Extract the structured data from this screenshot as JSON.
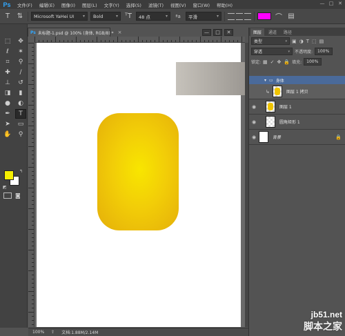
{
  "app": {
    "logo": "Ps"
  },
  "menu": [
    "文件(F)",
    "编辑(E)",
    "图像(I)",
    "图层(L)",
    "文字(Y)",
    "选择(S)",
    "滤镜(T)",
    "视图(V)",
    "窗口(W)",
    "帮助(H)"
  ],
  "window_controls": {
    "minimize": "—",
    "maximize": "□",
    "close": "✕"
  },
  "options": {
    "font_family": "Microsoft YaHei UI",
    "font_style": "Bold",
    "font_size": "48 点",
    "aa_label": "ªa",
    "antialias": "平滑",
    "text_color": "#ff00ff"
  },
  "tools": {
    "foreground_color": "#f5ef00",
    "background_color": "#ffffff"
  },
  "document": {
    "tab_title": "未标题-1.psd @ 100% (身体, RGB/8) *",
    "tab_close": "×",
    "shape_color": "#f2cd08"
  },
  "status": {
    "zoom": "100%",
    "doc_info": "文档:1.88M/2.14M"
  },
  "layers_panel": {
    "tabs": [
      "图层",
      "通道",
      "路径"
    ],
    "filter_type": "类型",
    "blend_mode": "穿透",
    "opacity_label": "不透明度:",
    "opacity_value": "100%",
    "lock_label": "锁定:",
    "fill_label": "填充:",
    "fill_value": "100%",
    "group_name": "身体",
    "layers": [
      {
        "name": "图层 1 拷贝"
      },
      {
        "name": "图层 1"
      },
      {
        "name": "圆角矩形 1"
      },
      {
        "name": "背景"
      }
    ]
  },
  "watermark": {
    "site": "jb51.net",
    "brand": "脚本之家"
  }
}
